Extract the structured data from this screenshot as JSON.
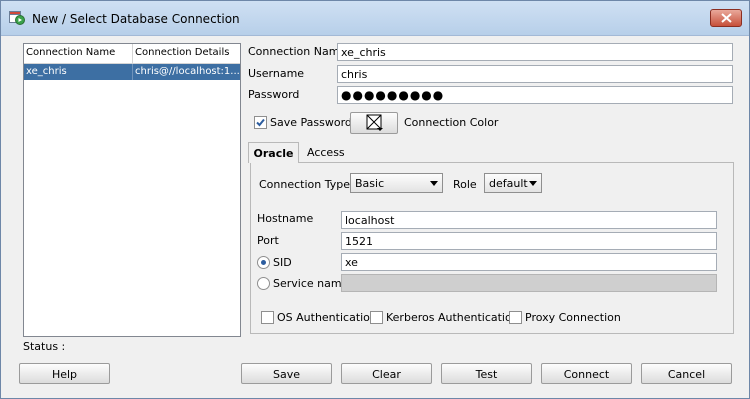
{
  "window": {
    "title": "New / Select Database Connection"
  },
  "list": {
    "headers": [
      "Connection Name",
      "Connection Details"
    ],
    "rows": [
      {
        "name": "xe_chris",
        "details": "chris@//localhost:1..."
      }
    ]
  },
  "form": {
    "connection_name_label": "Connection Name",
    "connection_name_value": "xe_chris",
    "username_label": "Username",
    "username_value": "chris",
    "password_label": "Password",
    "password_value": "●●●●●●●●●",
    "save_password_label": "Save Password",
    "save_password_checked": true,
    "connection_color_label": "Connection Color"
  },
  "tabs": [
    {
      "label": "Oracle",
      "active": true
    },
    {
      "label": "Access",
      "active": false
    }
  ],
  "oracle": {
    "connection_type_label": "Connection Type",
    "connection_type_value": "Basic",
    "role_label": "Role",
    "role_value": "default",
    "hostname_label": "Hostname",
    "hostname_value": "localhost",
    "port_label": "Port",
    "port_value": "1521",
    "sid_label": "SID",
    "sid_value": "xe",
    "service_name_label": "Service name",
    "service_name_value": "",
    "os_auth_label": "OS Authentication",
    "kerberos_label": "Kerberos Authentication",
    "proxy_label": "Proxy Connection"
  },
  "status": {
    "label": "Status :"
  },
  "buttons": {
    "help": "Help",
    "save": "Save",
    "clear": "Clear",
    "test": "Test",
    "connect": "Connect",
    "cancel": "Cancel"
  },
  "colors": {
    "selection": "#3d6fa3",
    "window_bg": "#f0f0f0",
    "titlebar": "#c4d8ee",
    "close": "#c7503a"
  }
}
